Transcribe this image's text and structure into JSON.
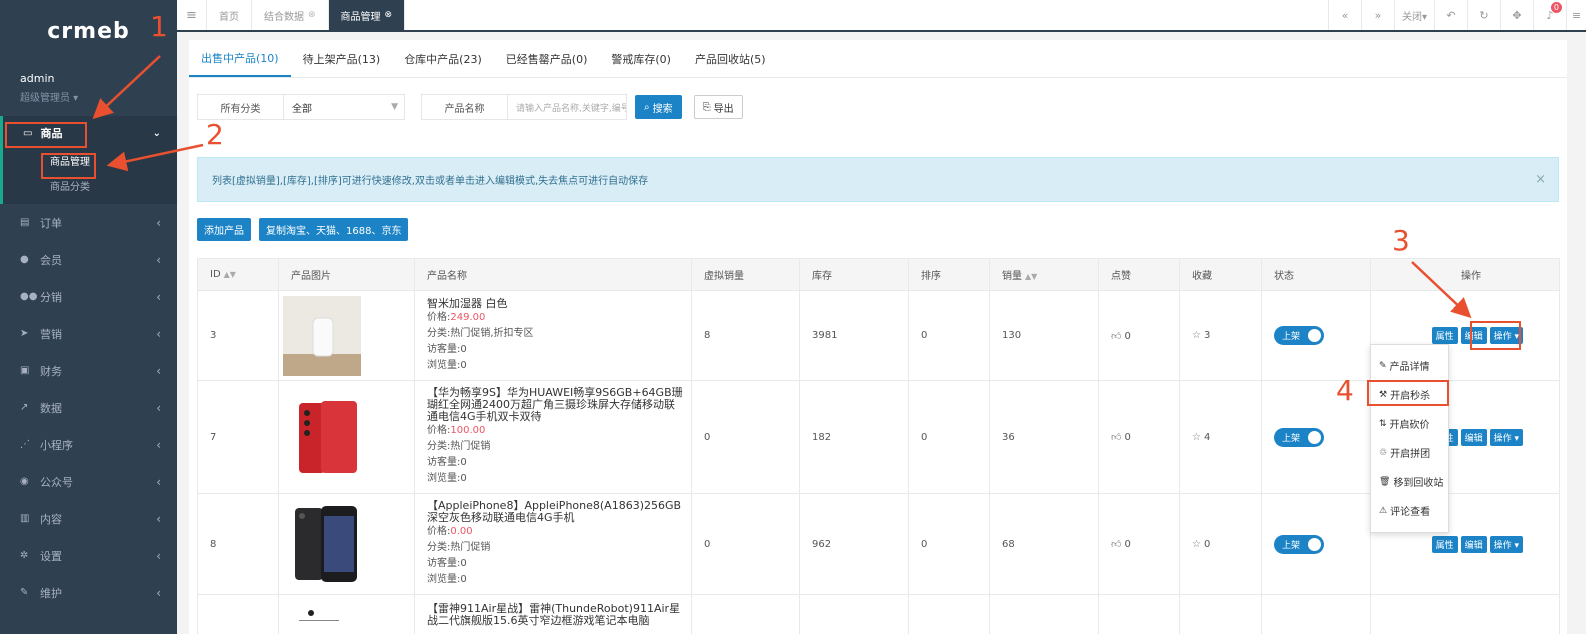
{
  "sidebar": {
    "logo": "crmeb",
    "user": {
      "name": "admin",
      "role": "超级管理员 ▾"
    },
    "active_group": {
      "label": "商品",
      "icon": "monitor-icon"
    },
    "sub_items": [
      {
        "label": "商品管理"
      },
      {
        "label": "商品分类"
      }
    ],
    "items": [
      {
        "label": "订单",
        "icon": "doc-icon"
      },
      {
        "label": "会员",
        "icon": "user-icon"
      },
      {
        "label": "分销",
        "icon": "users-icon"
      },
      {
        "label": "营销",
        "icon": "send-icon"
      },
      {
        "label": "财务",
        "icon": "money-icon"
      },
      {
        "label": "数据",
        "icon": "chart-icon"
      },
      {
        "label": "小程序",
        "icon": "share-icon"
      },
      {
        "label": "公众号",
        "icon": "wechat-icon"
      },
      {
        "label": "内容",
        "icon": "book-icon"
      },
      {
        "label": "设置",
        "icon": "gear-icon"
      },
      {
        "label": "维护",
        "icon": "wrench-icon"
      }
    ]
  },
  "topbar": {
    "tabs": [
      {
        "label": "首页"
      },
      {
        "label": "结合数据"
      },
      {
        "label": "商品管理"
      }
    ],
    "close_label": "关闭▾",
    "notification_count": "0"
  },
  "product_tabs": [
    {
      "label": "出售中产品(10)"
    },
    {
      "label": "待上架产品(13)"
    },
    {
      "label": "仓库中产品(23)"
    },
    {
      "label": "已经售罄产品(0)"
    },
    {
      "label": "警戒库存(0)"
    },
    {
      "label": "产品回收站(5)"
    }
  ],
  "filters": {
    "category_label": "所有分类",
    "category_value": "全部",
    "name_label": "产品名称",
    "name_placeholder": "请输入产品名称,关键字,编号",
    "search_label": "搜索",
    "export_label": "导出"
  },
  "alert_text": "列表[虚拟销量],[库存],[排序]可进行快速修改,双击或者单击进入编辑模式,失去焦点可进行自动保存",
  "actions": {
    "add": "添加产品",
    "copy": "复制淘宝、天猫、1688、京东"
  },
  "table": {
    "headers": [
      "ID",
      "产品图片",
      "产品名称",
      "虚拟销量",
      "库存",
      "排序",
      "销量",
      "点赞",
      "收藏",
      "状态",
      "操作"
    ],
    "rows": [
      {
        "id": "3",
        "name": "智米加湿器 白色",
        "price_label": "价格:",
        "price": "249.00",
        "category": "分类:热门促销,折扣专区",
        "visitors": "访客量:0",
        "views": "浏览量:0",
        "virtual_sales": "8",
        "stock": "3981",
        "sort": "0",
        "sales": "130",
        "likes": "0",
        "favorites": "3",
        "status": "上架"
      },
      {
        "id": "7",
        "name": "【华为畅享9S】华为HUAWEI畅享9S6GB+64GB珊瑚红全网通2400万超广角三摄珍珠屏大存储移动联通电信4G手机双卡双待",
        "price_label": "价格:",
        "price": "100.00",
        "category": "分类:热门促销",
        "visitors": "访客量:0",
        "views": "浏览量:0",
        "virtual_sales": "0",
        "stock": "182",
        "sort": "0",
        "sales": "36",
        "likes": "0",
        "favorites": "4",
        "status": "上架"
      },
      {
        "id": "8",
        "name": "【AppleiPhone8】AppleiPhone8(A1863)256GB深空灰色移动联通电信4G手机",
        "price_label": "价格:",
        "price": "0.00",
        "category": "分类:热门促销",
        "visitors": "访客量:0",
        "views": "浏览量:0",
        "virtual_sales": "0",
        "stock": "962",
        "sort": "0",
        "sales": "68",
        "likes": "0",
        "favorites": "0",
        "status": "上架"
      },
      {
        "id": "",
        "name": "【雷神911Air星战】雷神(ThundeRobot)911Air星战二代旗舰版15.6英寸窄边框游戏笔记本电脑",
        "price_label": "",
        "price": "",
        "category": "",
        "visitors": "",
        "views": "",
        "virtual_sales": "",
        "stock": "",
        "sort": "",
        "sales": "",
        "likes": "",
        "favorites": "",
        "status": ""
      }
    ],
    "row_buttons": {
      "attr": "属性",
      "edit": "编辑",
      "ops": "操作 ▾"
    }
  },
  "dropdown": [
    {
      "label": "产品详情",
      "icon": "pencil-icon"
    },
    {
      "label": "开启秒杀",
      "icon": "hammer-icon"
    },
    {
      "label": "开启砍价",
      "icon": "sort-icon"
    },
    {
      "label": "开启拼团",
      "icon": "group-icon"
    },
    {
      "label": "移到回收站",
      "icon": "trash-icon"
    },
    {
      "label": "评论查看",
      "icon": "warning-icon"
    }
  ],
  "annotations": [
    "1",
    "2",
    "3",
    "4"
  ],
  "colors": {
    "sidebar": "#2f4050",
    "primary": "#1c84c6",
    "annotation": "#e8502f",
    "price": "#ed5565"
  }
}
